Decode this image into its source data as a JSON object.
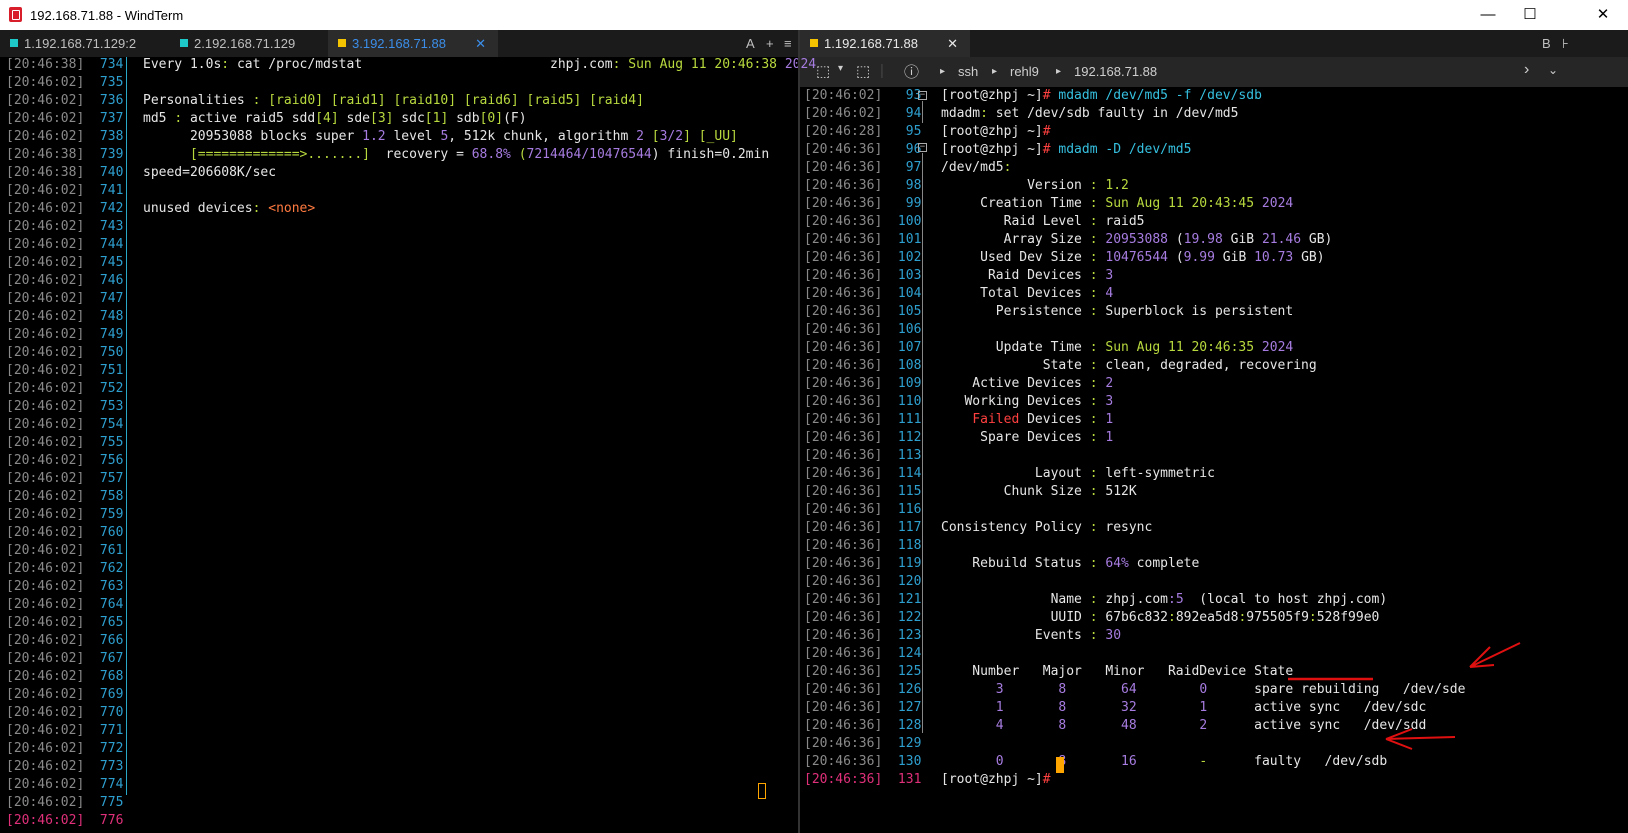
{
  "window": {
    "title": "192.168.71.88 - WindTerm",
    "minimize": "—",
    "maximize": "☐"
  },
  "left_tabs": [
    {
      "label": "1.192.168.71.129:2",
      "color": "#1ec8c8",
      "active": false
    },
    {
      "label": "2.192.168.71.129",
      "color": "#1ec8c8",
      "active": false
    },
    {
      "label": "3.192.168.71.88",
      "color": "#f5c400",
      "active": true
    }
  ],
  "left_tab_close": "✕",
  "left_tab_buttons": [
    "A",
    "+",
    "≡"
  ],
  "right_tabs": [
    {
      "label": "1.192.168.71.88",
      "color": "#f5c400",
      "active": true
    }
  ],
  "right_tab_close": "✕",
  "right_tab_buttons": [
    "B"
  ],
  "toolbar": {
    "icons": [
      "new-session-icon",
      "dropdown-icon",
      "duplicate-icon",
      "info-icon"
    ],
    "breadcrumb": [
      "ssh",
      "rehl9",
      "192.168.71.88"
    ],
    "sep": "▸",
    "right_icons": [
      "chevron-right-icon",
      "chevron-down-icon"
    ]
  },
  "left_pane": {
    "gutter": [
      {
        "ts": "[20:46:38]",
        "ln": "734"
      },
      {
        "ts": "[20:46:02]",
        "ln": "735"
      },
      {
        "ts": "[20:46:02]",
        "ln": "736"
      },
      {
        "ts": "[20:46:02]",
        "ln": "737"
      },
      {
        "ts": "[20:46:02]",
        "ln": "738"
      },
      {
        "ts": "[20:46:38]",
        "ln": "739"
      },
      {
        "ts": "[20:46:38]",
        "ln": "740"
      },
      {
        "ts": "[20:46:02]",
        "ln": "741"
      },
      {
        "ts": "[20:46:02]",
        "ln": "742"
      },
      {
        "ts": "[20:46:02]",
        "ln": "743"
      },
      {
        "ts": "[20:46:02]",
        "ln": "744"
      },
      {
        "ts": "[20:46:02]",
        "ln": "745"
      },
      {
        "ts": "[20:46:02]",
        "ln": "746"
      },
      {
        "ts": "[20:46:02]",
        "ln": "747"
      },
      {
        "ts": "[20:46:02]",
        "ln": "748"
      },
      {
        "ts": "[20:46:02]",
        "ln": "749"
      },
      {
        "ts": "[20:46:02]",
        "ln": "750"
      },
      {
        "ts": "[20:46:02]",
        "ln": "751"
      },
      {
        "ts": "[20:46:02]",
        "ln": "752"
      },
      {
        "ts": "[20:46:02]",
        "ln": "753"
      },
      {
        "ts": "[20:46:02]",
        "ln": "754"
      },
      {
        "ts": "[20:46:02]",
        "ln": "755"
      },
      {
        "ts": "[20:46:02]",
        "ln": "756"
      },
      {
        "ts": "[20:46:02]",
        "ln": "757"
      },
      {
        "ts": "[20:46:02]",
        "ln": "758"
      },
      {
        "ts": "[20:46:02]",
        "ln": "759"
      },
      {
        "ts": "[20:46:02]",
        "ln": "760"
      },
      {
        "ts": "[20:46:02]",
        "ln": "761"
      },
      {
        "ts": "[20:46:02]",
        "ln": "762"
      },
      {
        "ts": "[20:46:02]",
        "ln": "763"
      },
      {
        "ts": "[20:46:02]",
        "ln": "764"
      },
      {
        "ts": "[20:46:02]",
        "ln": "765"
      },
      {
        "ts": "[20:46:02]",
        "ln": "766"
      },
      {
        "ts": "[20:46:02]",
        "ln": "767"
      },
      {
        "ts": "[20:46:02]",
        "ln": "768"
      },
      {
        "ts": "[20:46:02]",
        "ln": "769"
      },
      {
        "ts": "[20:46:02]",
        "ln": "770"
      },
      {
        "ts": "[20:46:02]",
        "ln": "771"
      },
      {
        "ts": "[20:46:02]",
        "ln": "772"
      },
      {
        "ts": "[20:46:02]",
        "ln": "773"
      },
      {
        "ts": "[20:46:02]",
        "ln": "774"
      },
      {
        "ts": "[20:46:02]",
        "ln": "775"
      },
      {
        "ts": "[20:46:02]",
        "ln": "776",
        "current": true
      }
    ],
    "lines": [
      [
        [
          "Every 1.0s",
          ""
        ],
        [
          ": ",
          "g"
        ],
        [
          "cat /proc/mdstat                        zhpj.com",
          ""
        ],
        [
          ": ",
          "g"
        ],
        [
          "Sun Aug 11 ",
          "g"
        ],
        [
          "20:46:38 ",
          "g"
        ],
        [
          "2024",
          "p"
        ]
      ],
      [],
      [
        [
          "Personalities ",
          ""
        ],
        [
          ": ",
          "g"
        ],
        [
          "[raid0] [raid1] [raid10] [raid6] [raid5] [raid4]",
          "g"
        ]
      ],
      [
        [
          "md5 ",
          ""
        ],
        [
          ": ",
          "g"
        ],
        [
          "active raid5 sdd",
          ""
        ],
        [
          "[4]",
          "g"
        ],
        [
          " sde",
          ""
        ],
        [
          "[3]",
          "g"
        ],
        [
          " sdc",
          ""
        ],
        [
          "[1]",
          "g"
        ],
        [
          " sdb",
          ""
        ],
        [
          "[0]",
          "g"
        ],
        [
          "(F)",
          ""
        ]
      ],
      [
        [
          "      20953088",
          ""
        ],
        [
          " blocks super ",
          ""
        ],
        [
          "1.2",
          "p"
        ],
        [
          " level ",
          ""
        ],
        [
          "5",
          "p"
        ],
        [
          ", 512k chunk, algorithm ",
          ""
        ],
        [
          "2",
          "p"
        ],
        [
          " [",
          "g"
        ],
        [
          "3/2",
          "p"
        ],
        [
          "] [_UU]",
          "g"
        ]
      ],
      [
        [
          "      [=============>.......]",
          "g"
        ],
        [
          "  recovery = ",
          ""
        ],
        [
          "68.8%",
          "p"
        ],
        [
          " (",
          "g"
        ],
        [
          "7214464/10476544",
          "p"
        ],
        [
          ") finish=0.2min",
          ""
        ]
      ],
      [
        [
          "speed=206608K/sec",
          ""
        ]
      ],
      [],
      [
        [
          "unused devices",
          ""
        ],
        [
          ": ",
          "g"
        ],
        [
          "<",
          "o"
        ],
        [
          "none",
          "o"
        ],
        [
          ">",
          "o"
        ]
      ]
    ]
  },
  "right_pane": {
    "gutter": [
      {
        "ts": "[20:46:02]",
        "ln": "93"
      },
      {
        "ts": "[20:46:02]",
        "ln": "94"
      },
      {
        "ts": "[20:46:28]",
        "ln": "95"
      },
      {
        "ts": "[20:46:36]",
        "ln": "96"
      },
      {
        "ts": "[20:46:36]",
        "ln": "97"
      },
      {
        "ts": "[20:46:36]",
        "ln": "98"
      },
      {
        "ts": "[20:46:36]",
        "ln": "99"
      },
      {
        "ts": "[20:46:36]",
        "ln": "100"
      },
      {
        "ts": "[20:46:36]",
        "ln": "101"
      },
      {
        "ts": "[20:46:36]",
        "ln": "102"
      },
      {
        "ts": "[20:46:36]",
        "ln": "103"
      },
      {
        "ts": "[20:46:36]",
        "ln": "104"
      },
      {
        "ts": "[20:46:36]",
        "ln": "105"
      },
      {
        "ts": "[20:46:36]",
        "ln": "106"
      },
      {
        "ts": "[20:46:36]",
        "ln": "107"
      },
      {
        "ts": "[20:46:36]",
        "ln": "108"
      },
      {
        "ts": "[20:46:36]",
        "ln": "109"
      },
      {
        "ts": "[20:46:36]",
        "ln": "110"
      },
      {
        "ts": "[20:46:36]",
        "ln": "111"
      },
      {
        "ts": "[20:46:36]",
        "ln": "112"
      },
      {
        "ts": "[20:46:36]",
        "ln": "113"
      },
      {
        "ts": "[20:46:36]",
        "ln": "114"
      },
      {
        "ts": "[20:46:36]",
        "ln": "115"
      },
      {
        "ts": "[20:46:36]",
        "ln": "116"
      },
      {
        "ts": "[20:46:36]",
        "ln": "117"
      },
      {
        "ts": "[20:46:36]",
        "ln": "118"
      },
      {
        "ts": "[20:46:36]",
        "ln": "119"
      },
      {
        "ts": "[20:46:36]",
        "ln": "120"
      },
      {
        "ts": "[20:46:36]",
        "ln": "121"
      },
      {
        "ts": "[20:46:36]",
        "ln": "122"
      },
      {
        "ts": "[20:46:36]",
        "ln": "123"
      },
      {
        "ts": "[20:46:36]",
        "ln": "124"
      },
      {
        "ts": "[20:46:36]",
        "ln": "125"
      },
      {
        "ts": "[20:46:36]",
        "ln": "126"
      },
      {
        "ts": "[20:46:36]",
        "ln": "127"
      },
      {
        "ts": "[20:46:36]",
        "ln": "128"
      },
      {
        "ts": "[20:46:36]",
        "ln": "129"
      },
      {
        "ts": "[20:46:36]",
        "ln": "130"
      },
      {
        "ts": "[20:46:36]",
        "ln": "131",
        "current": true
      }
    ],
    "lines": [
      [
        [
          "[root@zhpj ~]",
          ""
        ],
        [
          "#",
          "r"
        ],
        [
          " mdadm /dev/md5 -f /dev/sdb",
          "c"
        ]
      ],
      [
        [
          "mdadm",
          ""
        ],
        [
          ": ",
          "g"
        ],
        [
          "set /dev/sdb faulty in /dev/md5",
          ""
        ]
      ],
      [
        [
          "[root@zhpj ~]",
          ""
        ],
        [
          "#",
          "r"
        ]
      ],
      [
        [
          "[root@zhpj ~]",
          ""
        ],
        [
          "#",
          "r"
        ],
        [
          " mdadm -D /dev/md5",
          "c"
        ]
      ],
      [
        [
          "/dev/md5",
          ""
        ],
        [
          ":",
          "g"
        ]
      ],
      [
        [
          "           Version ",
          ""
        ],
        [
          ": ",
          "g"
        ],
        [
          "1.2",
          "g"
        ]
      ],
      [
        [
          "     Creation Time ",
          ""
        ],
        [
          ": ",
          "g"
        ],
        [
          "Sun Aug 11 20:43:45 ",
          "g"
        ],
        [
          "2024",
          "p"
        ]
      ],
      [
        [
          "        Raid Level ",
          ""
        ],
        [
          ": ",
          "g"
        ],
        [
          "raid5",
          ""
        ]
      ],
      [
        [
          "        Array Size ",
          ""
        ],
        [
          ": ",
          "g"
        ],
        [
          "20953088",
          "p"
        ],
        [
          " (",
          ""
        ],
        [
          "19.98",
          "p"
        ],
        [
          " GiB ",
          ""
        ],
        [
          "21.46",
          "p"
        ],
        [
          " GB)",
          ""
        ]
      ],
      [
        [
          "     Used Dev Size ",
          ""
        ],
        [
          ": ",
          "g"
        ],
        [
          "10476544",
          "p"
        ],
        [
          " (",
          ""
        ],
        [
          "9.99",
          "p"
        ],
        [
          " GiB ",
          ""
        ],
        [
          "10.73",
          "p"
        ],
        [
          " GB)",
          ""
        ]
      ],
      [
        [
          "      Raid Devices ",
          ""
        ],
        [
          ": ",
          "g"
        ],
        [
          "3",
          "p"
        ]
      ],
      [
        [
          "     Total Devices ",
          ""
        ],
        [
          ": ",
          "g"
        ],
        [
          "4",
          "p"
        ]
      ],
      [
        [
          "       Persistence ",
          ""
        ],
        [
          ": ",
          "g"
        ],
        [
          "Superblock is persistent",
          ""
        ]
      ],
      [],
      [
        [
          "       Update Time ",
          ""
        ],
        [
          ": ",
          "g"
        ],
        [
          "Sun Aug 11 20:46:35 ",
          "g"
        ],
        [
          "2024",
          "p"
        ]
      ],
      [
        [
          "             State ",
          ""
        ],
        [
          ": ",
          "g"
        ],
        [
          "clean, degraded, recovering",
          ""
        ]
      ],
      [
        [
          "    Active Devices ",
          ""
        ],
        [
          ": ",
          "g"
        ],
        [
          "2",
          "p"
        ]
      ],
      [
        [
          "   Working Devices ",
          ""
        ],
        [
          ": ",
          "g"
        ],
        [
          "3",
          "p"
        ]
      ],
      [
        [
          "    ",
          ""
        ],
        [
          "Failed",
          "r"
        ],
        [
          " Devices ",
          ""
        ],
        [
          ": ",
          "g"
        ],
        [
          "1",
          "p"
        ]
      ],
      [
        [
          "     Spare Devices ",
          ""
        ],
        [
          ": ",
          "g"
        ],
        [
          "1",
          "p"
        ]
      ],
      [],
      [
        [
          "            Layout ",
          ""
        ],
        [
          ": ",
          "g"
        ],
        [
          "left-symmetric",
          ""
        ]
      ],
      [
        [
          "        Chunk Size ",
          ""
        ],
        [
          ": ",
          "g"
        ],
        [
          "512K",
          ""
        ]
      ],
      [],
      [
        [
          "Consistency Policy ",
          ""
        ],
        [
          ": ",
          "g"
        ],
        [
          "resync",
          ""
        ]
      ],
      [],
      [
        [
          "    Rebuild Status ",
          ""
        ],
        [
          ": ",
          "g"
        ],
        [
          "64%",
          "p"
        ],
        [
          " complete",
          ""
        ]
      ],
      [],
      [
        [
          "              Name ",
          ""
        ],
        [
          ": ",
          "g"
        ],
        [
          "zhpj.com",
          ""
        ],
        [
          ":5",
          "p"
        ],
        [
          "  (local to host zhpj.com)",
          ""
        ]
      ],
      [
        [
          "              UUID ",
          ""
        ],
        [
          ": ",
          "g"
        ],
        [
          "67b6c832",
          ""
        ],
        [
          ":",
          "g"
        ],
        [
          "892ea5d8",
          ""
        ],
        [
          ":",
          "g"
        ],
        [
          "975505f9",
          ""
        ],
        [
          ":",
          "g"
        ],
        [
          "528f99e0",
          ""
        ]
      ],
      [
        [
          "            Events ",
          ""
        ],
        [
          ": ",
          "g"
        ],
        [
          "30",
          "p"
        ]
      ],
      [],
      [
        [
          "    Number   Major   Minor   RaidDevice State",
          ""
        ]
      ],
      [
        [
          "       ",
          ""
        ],
        [
          "3",
          "p"
        ],
        [
          "       ",
          ""
        ],
        [
          "8",
          "p"
        ],
        [
          "       ",
          ""
        ],
        [
          "64",
          "p"
        ],
        [
          "        ",
          ""
        ],
        [
          "0",
          "p"
        ],
        [
          "      spare rebuilding   /dev/sde",
          ""
        ]
      ],
      [
        [
          "       ",
          ""
        ],
        [
          "1",
          "p"
        ],
        [
          "       ",
          ""
        ],
        [
          "8",
          "p"
        ],
        [
          "       ",
          ""
        ],
        [
          "32",
          "p"
        ],
        [
          "        ",
          ""
        ],
        [
          "1",
          "p"
        ],
        [
          "      active sync   /dev/sdc",
          ""
        ]
      ],
      [
        [
          "       ",
          ""
        ],
        [
          "4",
          "p"
        ],
        [
          "       ",
          ""
        ],
        [
          "8",
          "p"
        ],
        [
          "       ",
          ""
        ],
        [
          "48",
          "p"
        ],
        [
          "        ",
          ""
        ],
        [
          "2",
          "p"
        ],
        [
          "      active sync   /dev/sdd",
          ""
        ]
      ],
      [],
      [
        [
          "       ",
          ""
        ],
        [
          "0",
          "p"
        ],
        [
          "       ",
          ""
        ],
        [
          "8",
          "p"
        ],
        [
          "       ",
          ""
        ],
        [
          "16",
          "p"
        ],
        [
          "        ",
          ""
        ],
        [
          "-",
          "g"
        ],
        [
          "      faulty   /dev/sdb",
          ""
        ]
      ],
      [
        [
          "[root@zhpj ~]",
          ""
        ],
        [
          "#",
          "r"
        ],
        [
          " ",
          ""
        ]
      ]
    ]
  },
  "colors": {
    "accent": "#3b8eea",
    "green": "#b8d93e",
    "purple": "#a67ce0",
    "cyan": "#36c0e0",
    "red": "#ff4040",
    "gutter_line": "#2aa8c8",
    "annotation": "#e01010",
    "cursor": "#ffa500"
  }
}
